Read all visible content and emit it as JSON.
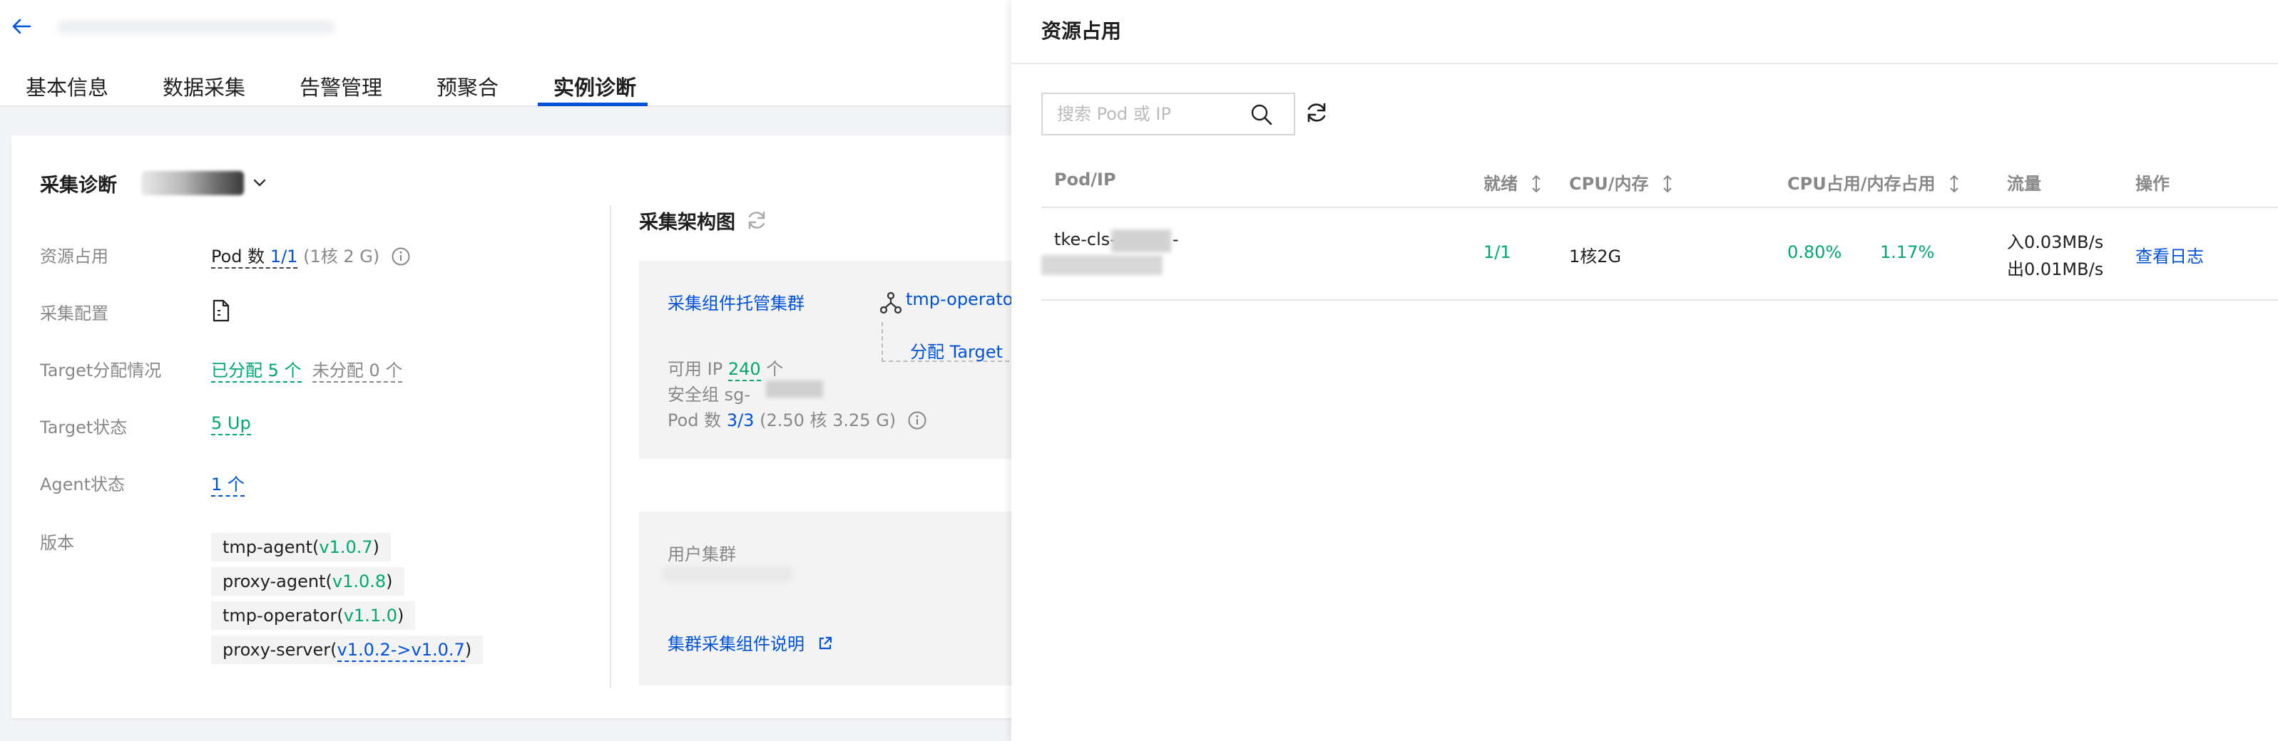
{
  "tabs": [
    {
      "label": "基本信息",
      "active": false
    },
    {
      "label": "数据采集",
      "active": false
    },
    {
      "label": "告警管理",
      "active": false
    },
    {
      "label": "预聚合",
      "active": false
    },
    {
      "label": "实例诊断",
      "active": true
    }
  ],
  "diagnosis": {
    "title": "采集诊断",
    "rows": {
      "resource": {
        "label": "资源占用",
        "pod_prefix": "Pod 数",
        "pod_count": "1/1",
        "pod_spec": "(1核 2 G)"
      },
      "config": {
        "label": "采集配置",
        "icon": "file-icon"
      },
      "target_assign": {
        "label": "Target分配情况",
        "assigned": "已分配 5 个",
        "unassigned": "未分配 0 个"
      },
      "target_status": {
        "label": "Target状态",
        "value": "5 Up"
      },
      "agent_status": {
        "label": "Agent状态",
        "value": "1 个"
      },
      "version": {
        "label": "版本"
      }
    },
    "versions": [
      {
        "name": "tmp-agent(",
        "ver": "v1.0.7",
        "close": ")"
      },
      {
        "name": "proxy-agent(",
        "ver": "v1.0.8",
        "close": ")"
      },
      {
        "name": "tmp-operator(",
        "ver": "v1.1.0",
        "close": ")"
      },
      {
        "name": "proxy-server(",
        "ver": "v1.0.2->v1.0.7",
        "close": ")"
      }
    ]
  },
  "architecture": {
    "title": "采集架构图",
    "managed_cluster": {
      "label": "采集组件托管集群",
      "operator": "tmp-operator-",
      "assign_target": "分配 Target",
      "ip_prefix": "可用 IP",
      "ip_count": "240",
      "ip_unit": "个",
      "sg_prefix": "安全组",
      "sg_value": "sg-",
      "pod_prefix": "Pod 数",
      "pod_count": "3/3",
      "pod_spec": "(2.50 核 3.25 G)"
    },
    "user_cluster": {
      "label": "用户集群",
      "doc_link": "集群采集组件说明"
    }
  },
  "drawer": {
    "title": "资源占用",
    "search_placeholder": "搜索 Pod 或 IP",
    "columns": [
      "Pod/IP",
      "就绪",
      "CPU/内存",
      "CPU占用/内存占用",
      "流量",
      "操作"
    ],
    "row": {
      "pod": "tke-cls-",
      "pod_suffix": "-",
      "ready": "1/1",
      "spec": "1核2G",
      "cpu_usage": "0.80%",
      "mem_usage": "1.17%",
      "traffic_in": "入0.03MB/s",
      "traffic_out": "出0.01MB/s",
      "action": "查看日志"
    }
  },
  "colors": {
    "primary": "#0052d9",
    "success": "#00a870",
    "muted": "#888888"
  }
}
